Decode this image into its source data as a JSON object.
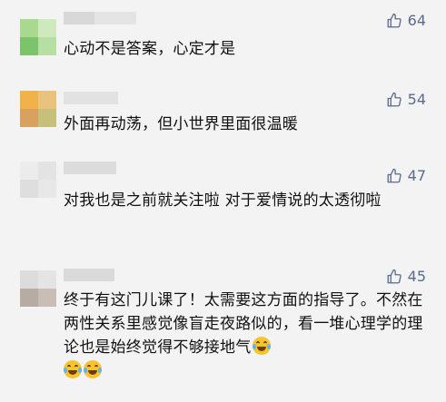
{
  "comments": [
    {
      "likes": "64",
      "text": "心动不是答案，心定才是",
      "emoji_count": 0
    },
    {
      "likes": "54",
      "text": "外面再动荡，但小世界里面很温暖",
      "emoji_count": 0
    },
    {
      "likes": "47",
      "text": "对我也是之前就关注啦 对于爱情说的太透彻啦",
      "emoji_count": 0
    },
    {
      "likes": "45",
      "text": "终于有这门儿课了！太需要这方面的指导了。不然在两性关系里感觉像盲走夜路似的，看一堆心理学的理论也是始终觉得不够接地气",
      "emoji": "grinning-tears-emoji",
      "emoji_count": 3
    }
  ],
  "icons": {
    "like": "thumbs-up-icon"
  },
  "colors": {
    "background": "#f3f3f3",
    "like": "#5a6b8c",
    "text": "#111111"
  }
}
